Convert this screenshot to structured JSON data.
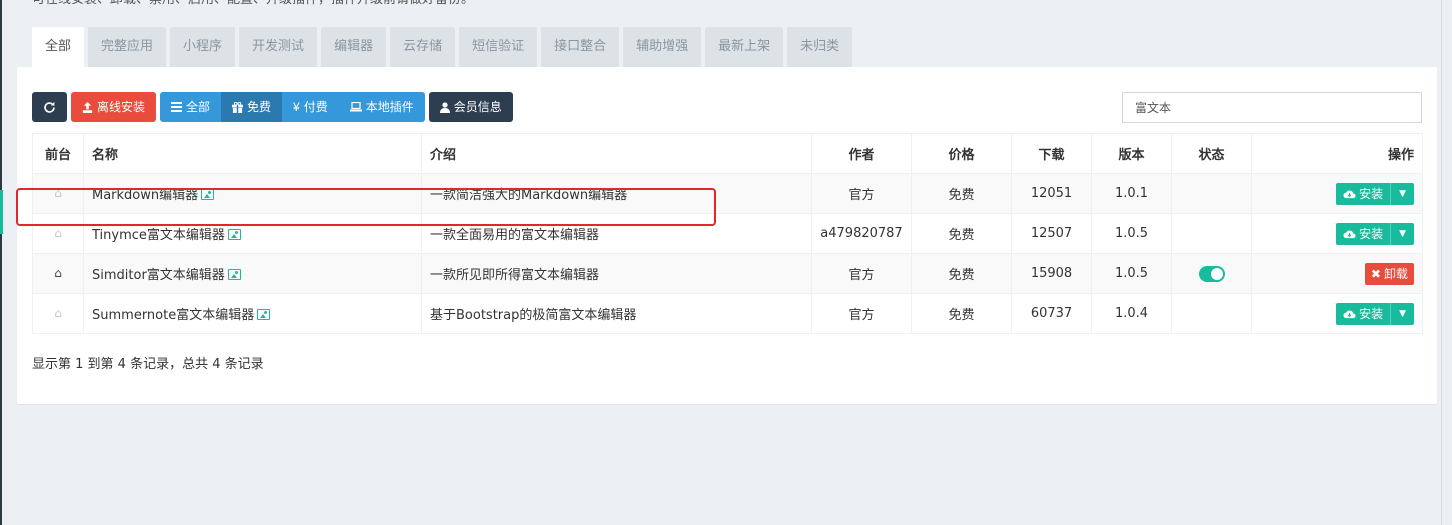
{
  "intro_text": "可在线安装、卸载、禁用、启用、配置、升级插件，插件升级前请做好备份。",
  "tabs": [
    {
      "label": "全部",
      "active": true
    },
    {
      "label": "完整应用"
    },
    {
      "label": "小程序"
    },
    {
      "label": "开发测试"
    },
    {
      "label": "编辑器"
    },
    {
      "label": "云存储"
    },
    {
      "label": "短信验证"
    },
    {
      "label": "接口整合"
    },
    {
      "label": "辅助增强"
    },
    {
      "label": "最新上架"
    },
    {
      "label": "未归类"
    }
  ],
  "toolbar": {
    "refresh_icon": "refresh-icon",
    "offline_install": "离线安装",
    "filter_all": "全部",
    "filter_free": "免费",
    "filter_paid": "付费",
    "filter_local": "本地插件",
    "member_info": "会员信息"
  },
  "search": {
    "value": "富文本"
  },
  "table": {
    "headers": {
      "front": "前台",
      "name": "名称",
      "intro": "介绍",
      "author": "作者",
      "price": "价格",
      "downloads": "下载",
      "version": "版本",
      "status": "状态",
      "actions": "操作"
    },
    "rows": [
      {
        "name": "Markdown编辑器",
        "intro": "一款简洁强大的Markdown编辑器",
        "author": "官方",
        "price": "免费",
        "downloads": "12051",
        "version": "1.0.1",
        "action": "安装"
      },
      {
        "name": "Tinymce富文本编辑器",
        "intro": "一款全面易用的富文本编辑器",
        "author": "a479820787",
        "price": "免费",
        "downloads": "12507",
        "version": "1.0.5",
        "action": "安装"
      },
      {
        "name": "Simditor富文本编辑器",
        "intro": "一款所见即所得富文本编辑器",
        "author": "官方",
        "price": "免费",
        "downloads": "15908",
        "version": "1.0.5",
        "action": "卸载"
      },
      {
        "name": "Summernote富文本编辑器",
        "intro": "基于Bootstrap的极简富文本编辑器",
        "author": "官方",
        "price": "免费",
        "downloads": "60737",
        "version": "1.0.4",
        "action": "安装"
      }
    ]
  },
  "summary": "显示第 1 到第 4 条记录，总共 4 条记录",
  "colors": {
    "primary": "#18bc9c",
    "danger": "#e74c3c",
    "info": "#3498db",
    "dark": "#2c3e50",
    "highlight": "#e3262c"
  }
}
